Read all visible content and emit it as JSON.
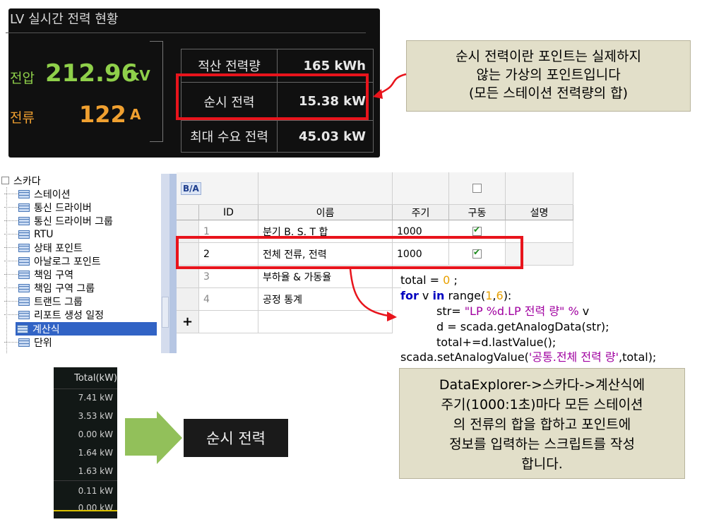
{
  "lv_panel": {
    "title": "LV 실시간 전력 현황",
    "voltage": {
      "label": "전압",
      "value": "212.96",
      "unit": "kV"
    },
    "current": {
      "label": "전류",
      "value": "122",
      "unit": "A"
    },
    "rows": [
      {
        "label": "적산 전력량",
        "value": "165 kWh"
      },
      {
        "label": "순시 전력",
        "value": "15.38 kW"
      },
      {
        "label": "최대 수요 전력",
        "value": "45.03 kW"
      }
    ]
  },
  "callout_top": {
    "line1": "순시 전력이란 포인트는 실제하지",
    "line2": "않는 가상의 포인트입니다",
    "line3": "(모든 스테이션 전력량의 합)"
  },
  "tree": {
    "root": "스카다",
    "items": [
      "스테이션",
      "통신 드라이버",
      "통신 드라이버 그룹",
      "RTU",
      "상태 포인트",
      "아날로그 포인트",
      "책임 구역",
      "책임 구역 그룹",
      "트랜드 그룹",
      "리포트 생성 일정",
      "계산식",
      "단위"
    ],
    "selected_index": 10
  },
  "grid": {
    "toolbar_icon": "B/A",
    "columns": [
      "ID",
      "이름",
      "주기",
      "구동",
      "설명"
    ],
    "rows": [
      {
        "id": "1",
        "name": "분기 B. S. T 합",
        "period": "1000",
        "enabled": true
      },
      {
        "id": "2",
        "name": "전체 전류, 전력",
        "period": "1000",
        "enabled": true
      },
      {
        "id": "3",
        "name": "부하율 & 가동율",
        "period": "",
        "enabled": false
      },
      {
        "id": "4",
        "name": "공정 통계",
        "period": "",
        "enabled": false
      }
    ],
    "add_symbol": "+"
  },
  "code": {
    "l1_a": "total",
    "l1_b": " = ",
    "l1_c": "0",
    "l1_d": " ;",
    "l2_kw1": "for",
    "l2_a": " v ",
    "l2_kw2": "in",
    "l2_b": " range(",
    "l2_n1": "1",
    "l2_c": ",",
    "l2_n2": "6",
    "l2_d": "):",
    "l3_a": "str= ",
    "l3_s": "\"LP %d.LP 전력 량\" %",
    "l3_b": " v",
    "l4": "d = scada.getAnalogData(str);",
    "l5": "total+=d.lastValue();",
    "l6_a": "scada.setAnalogValue(",
    "l6_s": "'공통.전체 전력 량'",
    "l6_b": ",total);"
  },
  "callout_bottom": {
    "line1": "DataExplorer->스카다->계산식에",
    "line2": "주기(1000:1초)마다  모든 스테이션",
    "line3": "의 전류의 합을 합하고 포인트에",
    "line4": "정보를 입력하는 스크립트를 작성",
    "line5": "합니다."
  },
  "mini_table": {
    "header": "Total(kW)",
    "values": [
      "7.41 kW",
      "3.53 kW",
      "0.00 kW",
      "1.64 kW",
      "1.63 kW",
      "0.11 kW",
      "0.00 kW"
    ]
  },
  "sunsi_label": "순시 전력",
  "colors": {
    "red": "#e8141c",
    "green": "#8fd04a",
    "orange": "#f0a030",
    "arrow_green": "#92c05a",
    "callout_bg": "#e2dfc9",
    "selection": "#3163c5"
  }
}
